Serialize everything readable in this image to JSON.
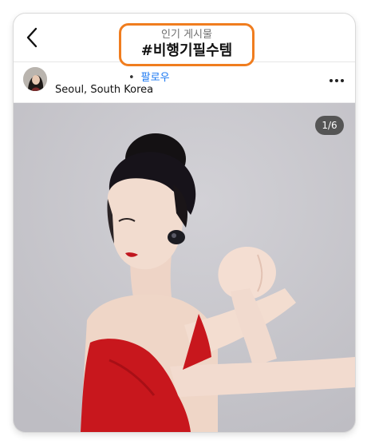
{
  "header": {
    "subtitle": "인기 게시물",
    "title": "#비행기필수템"
  },
  "post": {
    "follow_label": "팔로우",
    "location": "Seoul, South Korea",
    "image_counter": "1/6"
  },
  "colors": {
    "highlight_border": "#f07d1f",
    "follow_link": "#1877f2",
    "dress": "#c8171d",
    "background": "#c9c8cd"
  },
  "icons": {
    "back": "chevron-left-icon",
    "more": "more-horizontal-icon"
  }
}
